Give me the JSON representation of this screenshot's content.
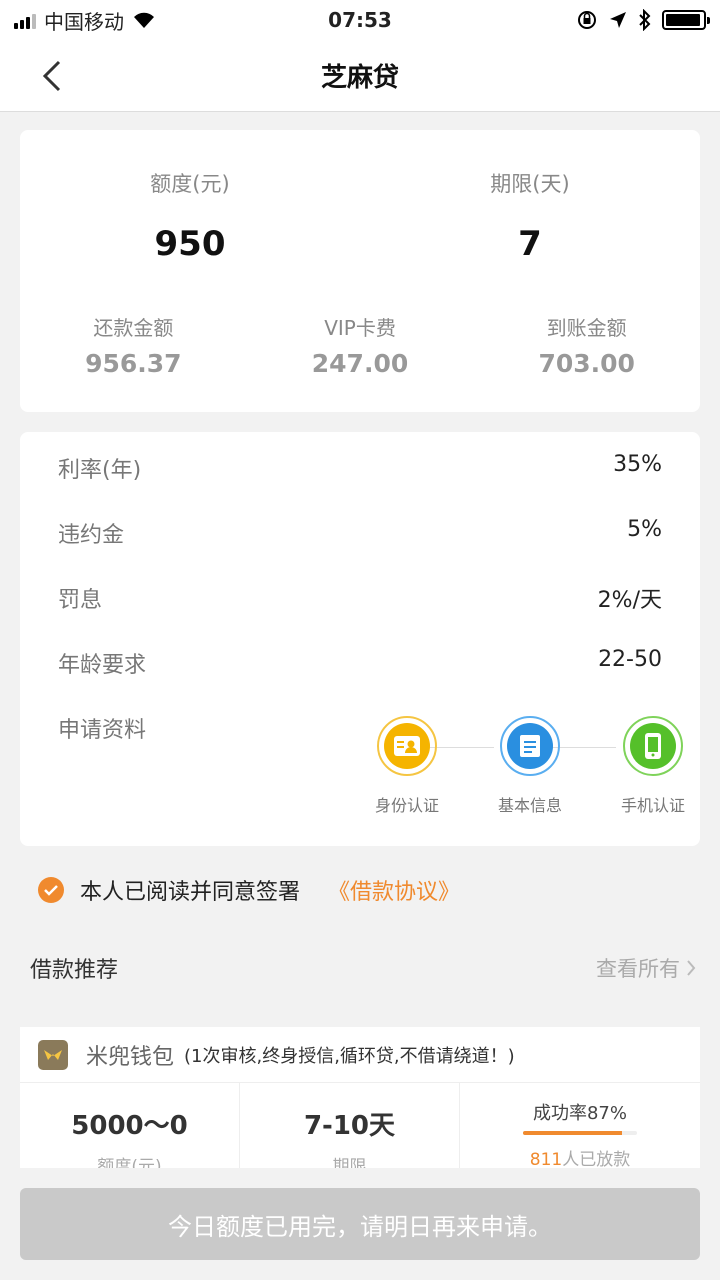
{
  "status_bar": {
    "carrier": "中国移动",
    "time": "07:53",
    "battery_level": 0.95
  },
  "nav": {
    "title": "芝麻贷",
    "back_icon": "chevron-left-icon"
  },
  "loan_summary": {
    "amount_label": "额度(元)",
    "amount_value": "950",
    "term_label": "期限(天)",
    "term_value": "7",
    "repay_label": "还款金额",
    "repay_value": "956.37",
    "vip_label": "VIP卡费",
    "vip_value": "247.00",
    "received_label": "到账金额",
    "received_value": "703.00"
  },
  "details": [
    {
      "label": "利率(年)",
      "value": "35%"
    },
    {
      "label": "违约金",
      "value": "5%"
    },
    {
      "label": "罚息",
      "value": "2%/天"
    },
    {
      "label": "年龄要求",
      "value": "22-50"
    }
  ],
  "materials": {
    "label": "申请资料",
    "items": [
      {
        "label": "身份认证",
        "icon": "id-card-icon",
        "color": "#f5b400"
      },
      {
        "label": "基本信息",
        "icon": "document-icon",
        "color": "#2a8fe0"
      },
      {
        "label": "手机认证",
        "icon": "phone-icon",
        "color": "#55c02a"
      }
    ]
  },
  "agreement": {
    "text": "本人已阅读并同意签署",
    "link": "《借款协议》"
  },
  "recommend": {
    "title": "借款推荐",
    "view_all": "查看所有",
    "item": {
      "name": "米兜钱包",
      "desc": "(1次审核,终身授信,循环贷,不借请绕道！)",
      "amount": "5000～0",
      "amount_label": "额度(元)",
      "term": "7-10天",
      "term_label": "期限",
      "success_rate": "成功率87%",
      "success_fraction": 0.87,
      "loaned_num": "811",
      "loaned_text": "人已放款"
    }
  },
  "apply_button": {
    "label": "今日额度已用完，请明日再来申请。"
  },
  "colors": {
    "accent": "#f08a2e",
    "disabled_button": "#c9c9c9"
  }
}
